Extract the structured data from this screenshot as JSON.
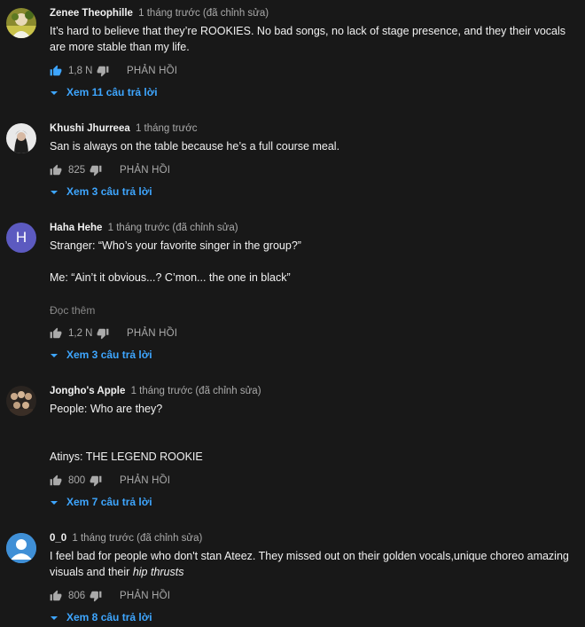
{
  "comments": [
    {
      "author": "Zenee Theophille",
      "time": "1 tháng trước (đã chỉnh sửa)",
      "lines": [
        "It’s hard to believe that they’re ROOKIES. No bad songs, no lack of stage presence, and they their vocals are more stable than my life."
      ],
      "likes": "1,8 N",
      "reply_label": "PHẢN HỒI",
      "replies_label": "Xem 11 câu trả lời",
      "avatar": "photo-avatar"
    },
    {
      "author": "Khushi Jhurreea",
      "time": "1 tháng trước",
      "lines": [
        "San is always on the table because he’s a full course meal."
      ],
      "likes": "825",
      "reply_label": "PHẢN HỒI",
      "replies_label": "Xem 3 câu trả lời",
      "avatar": "photo-avatar"
    },
    {
      "author": "Haha Hehe",
      "time": "1 tháng trước (đã chỉnh sửa)",
      "lines": [
        "Stranger: “Who’s your favorite singer in the group?”",
        "Me: “Ain’t it obvious...? C’mon... the one in black”"
      ],
      "read_more": "Đọc thêm",
      "likes": "1,2 N",
      "reply_label": "PHẢN HỒI",
      "replies_label": "Xem 3 câu trả lời",
      "avatar_letter": "H",
      "avatar_color": "#5c5ac0"
    },
    {
      "author": "Jongho's Apple",
      "time": "1 tháng trước (đã chỉnh sửa)",
      "lines": [
        "People: Who are they?",
        "Atinys: THE LEGEND ROOKIE"
      ],
      "likes": "800",
      "reply_label": "PHẢN HỒI",
      "replies_label": "Xem 7 câu trả lời",
      "avatar": "photo-avatar"
    },
    {
      "author": "0_0",
      "time": "1 tháng trước (đã chỉnh sửa)",
      "lines": [
        "I feel bad for people who don't stan Ateez. They missed out on their golden vocals,unique choreo amazing visuals and their "
      ],
      "emphasis": "hip thrusts",
      "likes": "806",
      "reply_label": "PHẢN HỒI",
      "replies_label": "Xem 8 câu trả lời",
      "avatar": "default-user-avatar",
      "avatar_color": "#3f8fd6"
    }
  ],
  "colors": {
    "background": "#181818",
    "text": "#f1f1f1",
    "secondary": "#aaaaaa",
    "link": "#3ea6ff"
  }
}
